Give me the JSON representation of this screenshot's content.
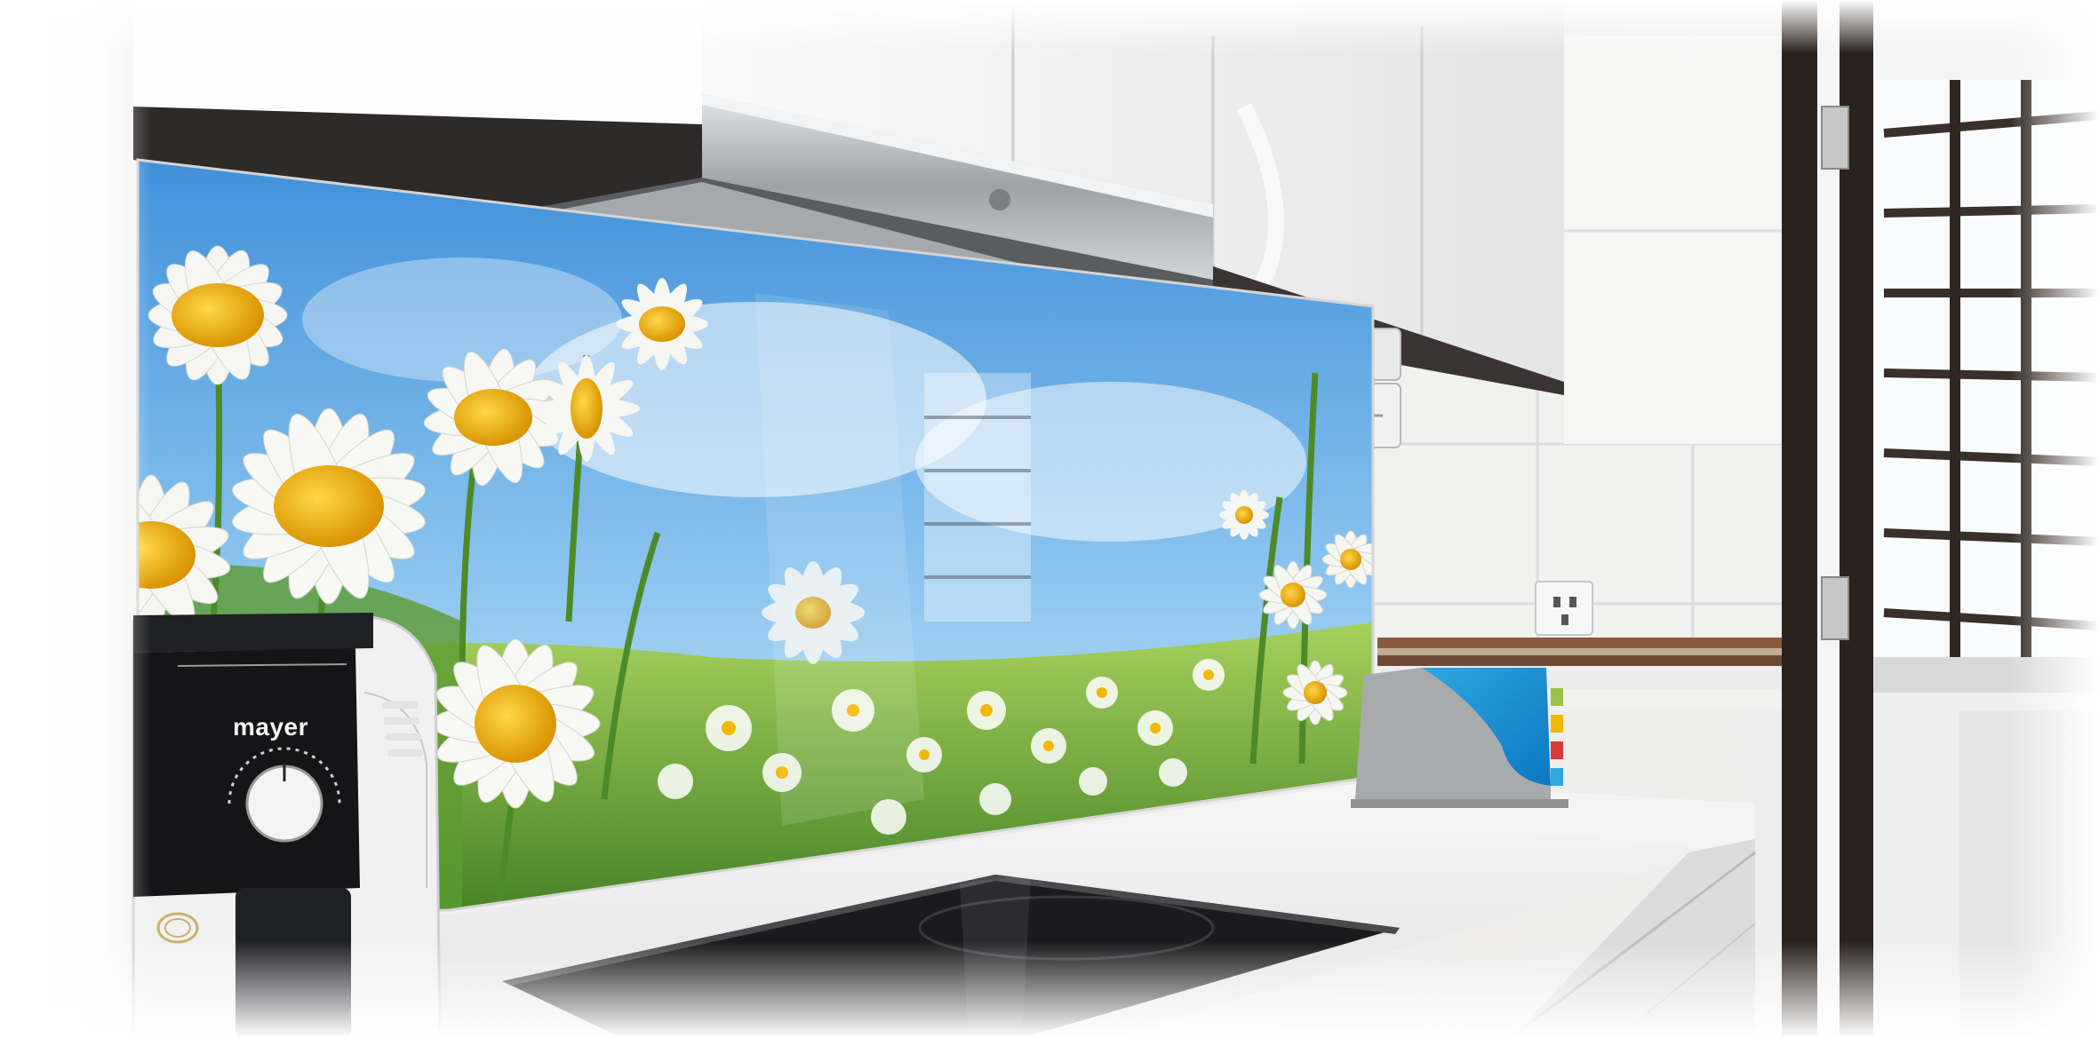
{
  "scene": {
    "description_name": "kitchen-backsplash-photo",
    "appliance_brand": "mayer",
    "colors": {
      "sky": "#5aa8e6",
      "grass": "#6fae3c",
      "petal": "#f7f7f4",
      "daisy_center": "#f2b705",
      "cabinet": "#f4f4f3",
      "hood_steel": "#b9bcbf",
      "window_frame": "#2a211d",
      "countertop": "#f2f2f2",
      "cooktop": "#1b1b1d"
    }
  }
}
